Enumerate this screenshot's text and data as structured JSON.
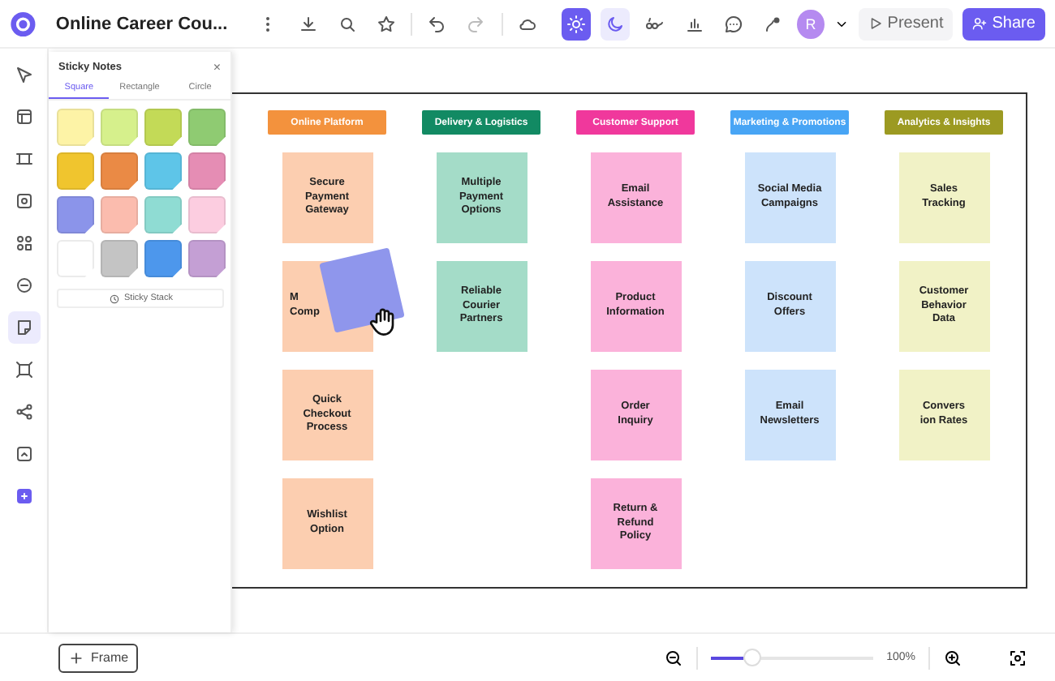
{
  "toolbar": {
    "title": "Online Career Cou...",
    "theme": [
      {
        "kind": "light",
        "selected": true
      },
      {
        "kind": "dark",
        "selected": false
      }
    ],
    "avatar": "R",
    "present": "Present",
    "share": "Share"
  },
  "rail": [
    {
      "selected": false
    },
    {
      "selected": false
    },
    {
      "selected": false
    },
    {
      "selected": false
    },
    {
      "selected": false
    },
    {
      "selected": false
    },
    {
      "selected": true
    },
    {
      "selected": false
    },
    {
      "selected": false
    },
    {
      "selected": false
    },
    {
      "selected": false
    }
  ],
  "sticky_panel": {
    "title": "Sticky Notes",
    "close": "×",
    "tabs": [
      {
        "label": "Square",
        "selected": true
      },
      {
        "label": "Rectangle",
        "selected": false
      },
      {
        "label": "Circle",
        "selected": false
      }
    ],
    "swatches": [
      {
        "color": "#fdf3a6"
      },
      {
        "color": "#d6f08c"
      },
      {
        "color": "#c3da57"
      },
      {
        "color": "#8fcb72"
      },
      {
        "color": "#f0c52e"
      },
      {
        "color": "#ea8a45"
      },
      {
        "color": "#5ec5e8"
      },
      {
        "color": "#e58db4"
      },
      {
        "color": "#8b94ea"
      },
      {
        "color": "#fbbcae"
      },
      {
        "color": "#8fdcd3"
      },
      {
        "color": "#fccde0"
      },
      {
        "color": "#ffffff"
      },
      {
        "color": "#c4c4c4"
      },
      {
        "color": "#4d97ec"
      },
      {
        "color": "#c49fd4"
      }
    ],
    "stack_button": "Sticky Stack"
  },
  "board": {
    "columns": [
      {
        "header": "Online Platform",
        "color": "#f3923d",
        "notes": [
          {
            "lines": [
              "Secure",
              "Payment",
              "Gateway"
            ],
            "color": "#fcceb0"
          },
          {
            "lines": [
              "M",
              "Comp"
            ],
            "covered": true,
            "color": "#fcceb0"
          },
          {
            "lines": [
              "Quick",
              "Checkout",
              "Process"
            ],
            "color": "#fcceb0"
          },
          {
            "lines": [
              "Wishlist",
              "Option"
            ],
            "color": "#fcceb0"
          }
        ]
      },
      {
        "header": "Delivery & Logistics",
        "color": "#128a63",
        "notes": [
          {
            "lines": [
              "Multiple",
              "Payment",
              "Options"
            ],
            "color": "#a4dcc8"
          },
          {
            "lines": [
              "Reliable",
              "Courier",
              "Partners"
            ],
            "color": "#a4dcc8"
          }
        ]
      },
      {
        "header": "Customer Support",
        "color": "#f0389c",
        "notes": [
          {
            "lines": [
              "Email",
              "Assistance"
            ],
            "color": "#fbb2da"
          },
          {
            "lines": [
              "Product",
              "Information"
            ],
            "color": "#fbb2da"
          },
          {
            "lines": [
              "Order",
              "Inquiry"
            ],
            "color": "#fbb2da"
          },
          {
            "lines": [
              "Return &",
              "Refund",
              "Policy"
            ],
            "color": "#fbb2da"
          }
        ]
      },
      {
        "header": "Marketing & Promotions",
        "color": "#48a5f5",
        "notes": [
          {
            "lines": [
              "Social Media",
              "Campaigns"
            ],
            "color": "#cde3fb"
          },
          {
            "lines": [
              "Discount",
              "Offers"
            ],
            "color": "#cde3fb"
          },
          {
            "lines": [
              "Email",
              "Newsletters"
            ],
            "color": "#cde3fb"
          }
        ]
      },
      {
        "header": "Analytics & Insights",
        "color": "#9c9a22",
        "notes": [
          {
            "lines": [
              "Sales",
              "Tracking"
            ],
            "color": "#f1f2c6"
          },
          {
            "lines": [
              "Customer",
              "Behavior",
              "Data"
            ],
            "color": "#f1f2c6"
          },
          {
            "lines": [
              "Convers",
              "ion Rates"
            ],
            "color": "#f1f2c6"
          }
        ]
      }
    ]
  },
  "bottom_bar": {
    "frame_button": "Frame",
    "zoom": {
      "level": 0.25,
      "reading": "100%"
    }
  }
}
